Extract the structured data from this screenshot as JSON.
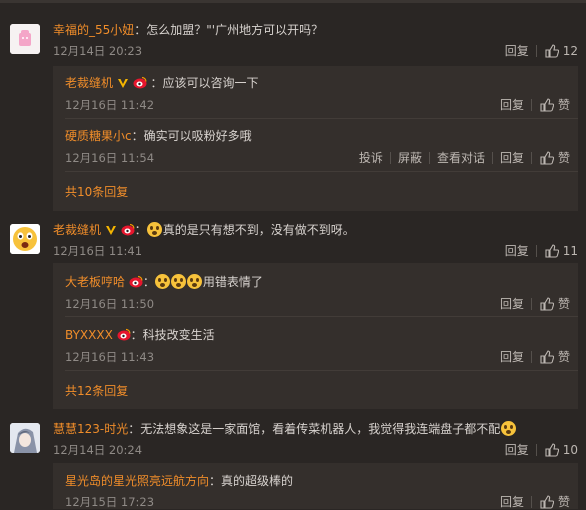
{
  "labels": {
    "reply": "回复",
    "like": "赞",
    "report": "投诉",
    "block": "屏蔽",
    "view_conversation": "查看对话"
  },
  "colors": {
    "username": "#f08d2a",
    "background": "#2a2624",
    "reply_background": "#342f2c"
  },
  "comments": [
    {
      "user": "幸福的_55小妞",
      "text": "：怎么加盟？\"'广州地方可以开吗？",
      "time": "12月14日 20:23",
      "likes": "12",
      "avatar": "pink-avatar-icon",
      "replies": [
        {
          "user": "老裁缝机",
          "badges": [
            "vip-v-icon",
            "sina-badge-icon"
          ],
          "text": "：应该可以咨询一下",
          "time": "12月16日 11:42"
        },
        {
          "user": "硬质糖果小c",
          "text": "：确实可以吸粉好多哦",
          "time": "12月16日 11:54"
        }
      ],
      "more": "共10条回复"
    },
    {
      "user": "老裁缝机",
      "badges": [
        "vip-v-icon",
        "sina-badge-icon"
      ],
      "text": "真的是只有想不到，没有做不到呀。",
      "time": "12月16日 11:41",
      "likes": "11",
      "avatar": "emoji-avatar-icon",
      "replies": [
        {
          "user": "大老板哼哈",
          "badges": [
            "sina-badge-icon"
          ],
          "text": "用错表情了",
          "time": "12月16日 11:50"
        },
        {
          "user": "BYXXXX",
          "badges": [
            "sina-badge-icon"
          ],
          "text": "：科技改变生活",
          "time": "12月16日 11:43"
        }
      ],
      "more": "共12条回复"
    },
    {
      "user": "慧慧123-时光",
      "text": "：无法想象这是一家面馆，看着传菜机器人，我觉得我连端盘子都不配",
      "time": "12月14日 20:24",
      "likes": "10",
      "avatar": "anime-avatar-icon",
      "replies": [
        {
          "user": "星光岛的星光照亮远航方向",
          "text": "：真的超级棒的",
          "time": "12月15日 17:23"
        }
      ]
    }
  ]
}
